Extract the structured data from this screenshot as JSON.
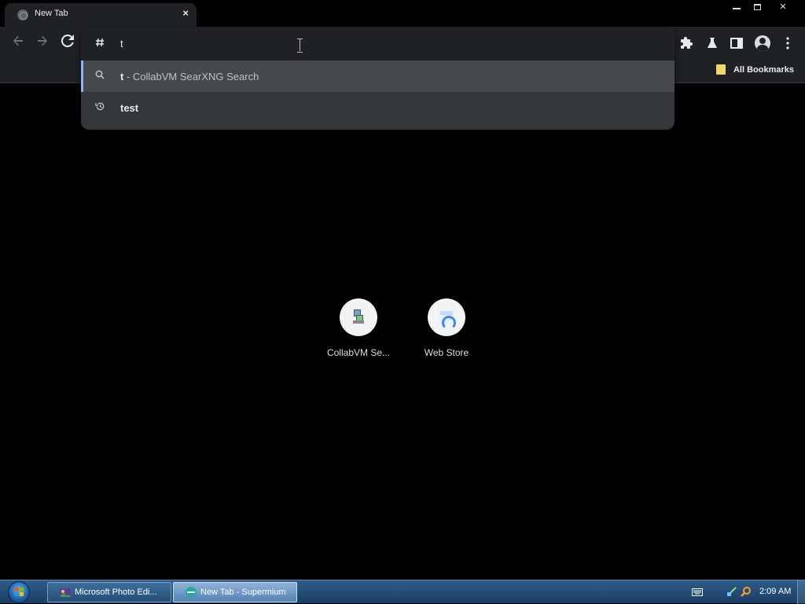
{
  "browser": {
    "tab": {
      "title": "New Tab",
      "close_label": "×"
    },
    "window_controls": {
      "close_label": "✕"
    }
  },
  "toolbar": {
    "back_icon": "arrow-left-icon",
    "forward_icon": "arrow-right-icon",
    "reload_icon": "reload-icon"
  },
  "omnibox": {
    "input_value": "t",
    "suggestions": [
      {
        "icon": "search-icon",
        "match": "t",
        "rest": " - CollabVM SearXNG Search",
        "selected": true
      },
      {
        "icon": "history-icon",
        "match": "test",
        "rest": "",
        "selected": false
      }
    ]
  },
  "bookmarks": {
    "folder_label": "All Bookmarks"
  },
  "shortcuts": [
    {
      "label": "CollabVM Se..."
    },
    {
      "label": "Web Store"
    }
  ],
  "taskbar": {
    "buttons": [
      {
        "label": "Microsoft Photo Edi...",
        "active": false
      },
      {
        "label": "New Tab - Supermium",
        "active": true
      }
    ],
    "clock": "2:09 AM"
  },
  "colors": {
    "accent": "#8ab4f8",
    "toolbar_bg": "#202124",
    "omnibox_bg": "#35363a",
    "page_bg": "#000000"
  }
}
